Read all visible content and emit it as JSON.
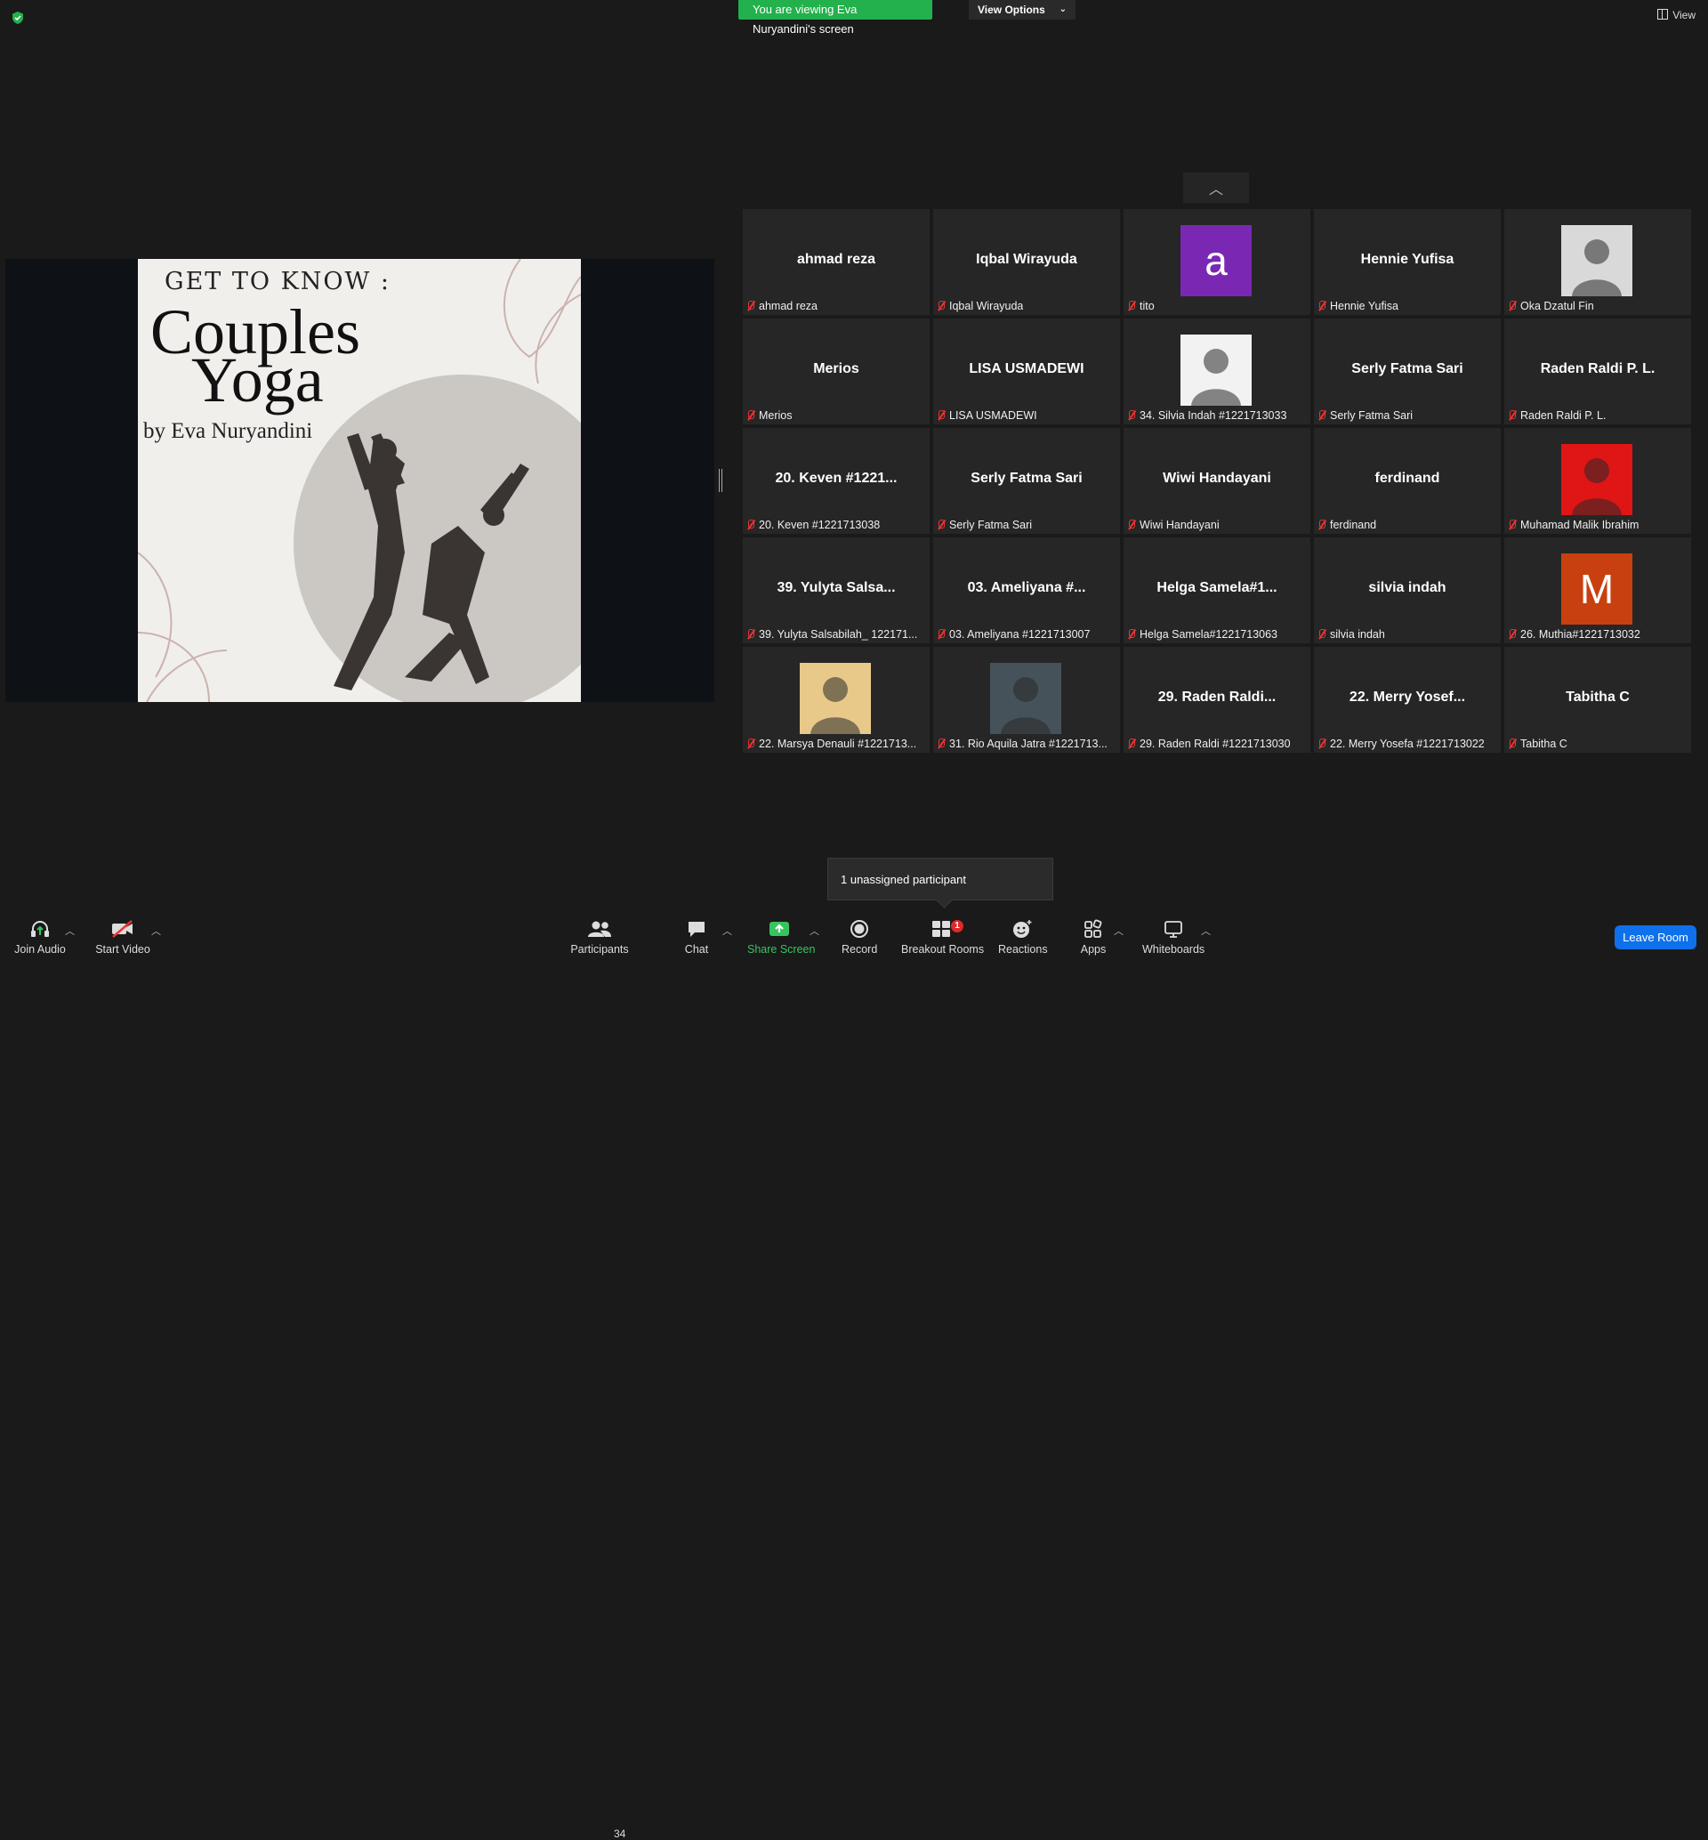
{
  "top_bar": {
    "viewing_banner": "You are viewing Eva Nuryandini's screen",
    "view_options": "View Options",
    "view_label": "View"
  },
  "slide": {
    "line1": "GET TO KNOW :",
    "line2": "Couples",
    "line3": "Yoga",
    "line4": "by Eva Nuryandini"
  },
  "participants": [
    {
      "display": "ahmad reza",
      "label": "ahmad reza",
      "type": "name"
    },
    {
      "display": "Iqbal Wirayuda",
      "label": "Iqbal Wirayuda",
      "type": "name"
    },
    {
      "display": "a",
      "label": "tito",
      "type": "letter",
      "color": "#7a28b4"
    },
    {
      "display": "Hennie Yufisa",
      "label": "Hennie Yufisa",
      "type": "name"
    },
    {
      "display": "",
      "label": "Oka Dzatul Fin",
      "type": "photo",
      "color": "#d9d9d9"
    },
    {
      "display": "Merios",
      "label": "Merios",
      "type": "name"
    },
    {
      "display": "LISA USMADEWI",
      "label": "LISA USMADEWI",
      "type": "name"
    },
    {
      "display": "",
      "label": "34. Silvia Indah #1221713033",
      "type": "photo",
      "color": "#f2f2f2"
    },
    {
      "display": "Serly Fatma Sari",
      "label": "Serly Fatma Sari",
      "type": "name"
    },
    {
      "display": "Raden Raldi P. L.",
      "label": "Raden Raldi P. L.",
      "type": "name"
    },
    {
      "display": "20. Keven #1221...",
      "label": "20. Keven #1221713038",
      "type": "name"
    },
    {
      "display": "Serly Fatma Sari",
      "label": "Serly Fatma Sari",
      "type": "name"
    },
    {
      "display": "Wiwi Handayani",
      "label": "Wiwi Handayani",
      "type": "name"
    },
    {
      "display": "ferdinand",
      "label": "ferdinand",
      "type": "name"
    },
    {
      "display": "",
      "label": "Muhamad Malik Ibrahim",
      "type": "photo",
      "color": "#e01515"
    },
    {
      "display": "39. Yulyta Salsa...",
      "label": "39. Yulyta Salsabilah_ 122171...",
      "type": "name"
    },
    {
      "display": "03. Ameliyana #...",
      "label": "03. Ameliyana #1221713007",
      "type": "name"
    },
    {
      "display": "Helga  Samela#1...",
      "label": "Helga Samela#1221713063",
      "type": "name"
    },
    {
      "display": "silvia indah",
      "label": "silvia indah",
      "type": "name"
    },
    {
      "display": "M",
      "label": "26. Muthia#1221713032",
      "type": "letter",
      "color": "#c8400f"
    },
    {
      "display": "",
      "label": "22. Marsya Denauli #1221713...",
      "type": "photo",
      "color": "#e9c98a"
    },
    {
      "display": "",
      "label": "31. Rio Aquila Jatra #1221713...",
      "type": "photo",
      "color": "#45525a"
    },
    {
      "display": "29. Raden Raldi...",
      "label": "29. Raden Raldi #1221713030",
      "type": "name"
    },
    {
      "display": "22. Merry Yosef...",
      "label": "22. Merry Yosefa #1221713022",
      "type": "name"
    },
    {
      "display": "Tabitha C",
      "label": "Tabitha C",
      "type": "name"
    }
  ],
  "tooltip": "1 unassigned participant",
  "toolbar": {
    "join_audio": "Join Audio",
    "start_video": "Start Video",
    "participants": "Participants",
    "participants_count": "34",
    "chat": "Chat",
    "share_screen": "Share Screen",
    "record": "Record",
    "breakout_rooms": "Breakout Rooms",
    "breakout_badge": "1",
    "reactions": "Reactions",
    "apps": "Apps",
    "whiteboards": "Whiteboards",
    "leave_room": "Leave Room"
  },
  "colors": {
    "banner_green": "#23b14d",
    "leave_blue": "#0e71eb",
    "mute_red": "#e33333"
  }
}
